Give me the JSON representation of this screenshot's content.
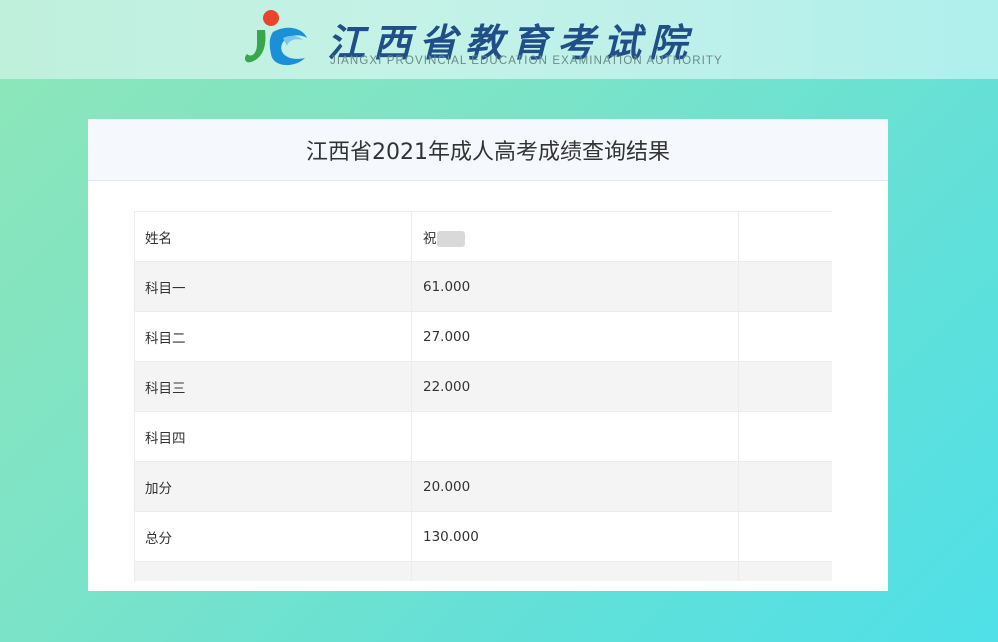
{
  "header": {
    "org_name_cn": "江西省教育考试院",
    "org_name_en": "JIANGXI PROVINCIAL EDUCATION EXAMINATION AUTHORITY"
  },
  "panel": {
    "title": "江西省2021年成人高考成绩查询结果"
  },
  "results": {
    "rows": [
      {
        "label": "姓名",
        "value": "祝",
        "masked": true
      },
      {
        "label": "科目一",
        "value": "61.000"
      },
      {
        "label": "科目二",
        "value": "27.000"
      },
      {
        "label": "科目三",
        "value": "22.000"
      },
      {
        "label": "科目四",
        "value": ""
      },
      {
        "label": "加分",
        "value": "20.000"
      },
      {
        "label": "总分",
        "value": "130.000"
      },
      {
        "label": "",
        "value": ""
      }
    ]
  },
  "colors": {
    "brand_blue": "#1f4f86",
    "title_text": "#333333"
  }
}
